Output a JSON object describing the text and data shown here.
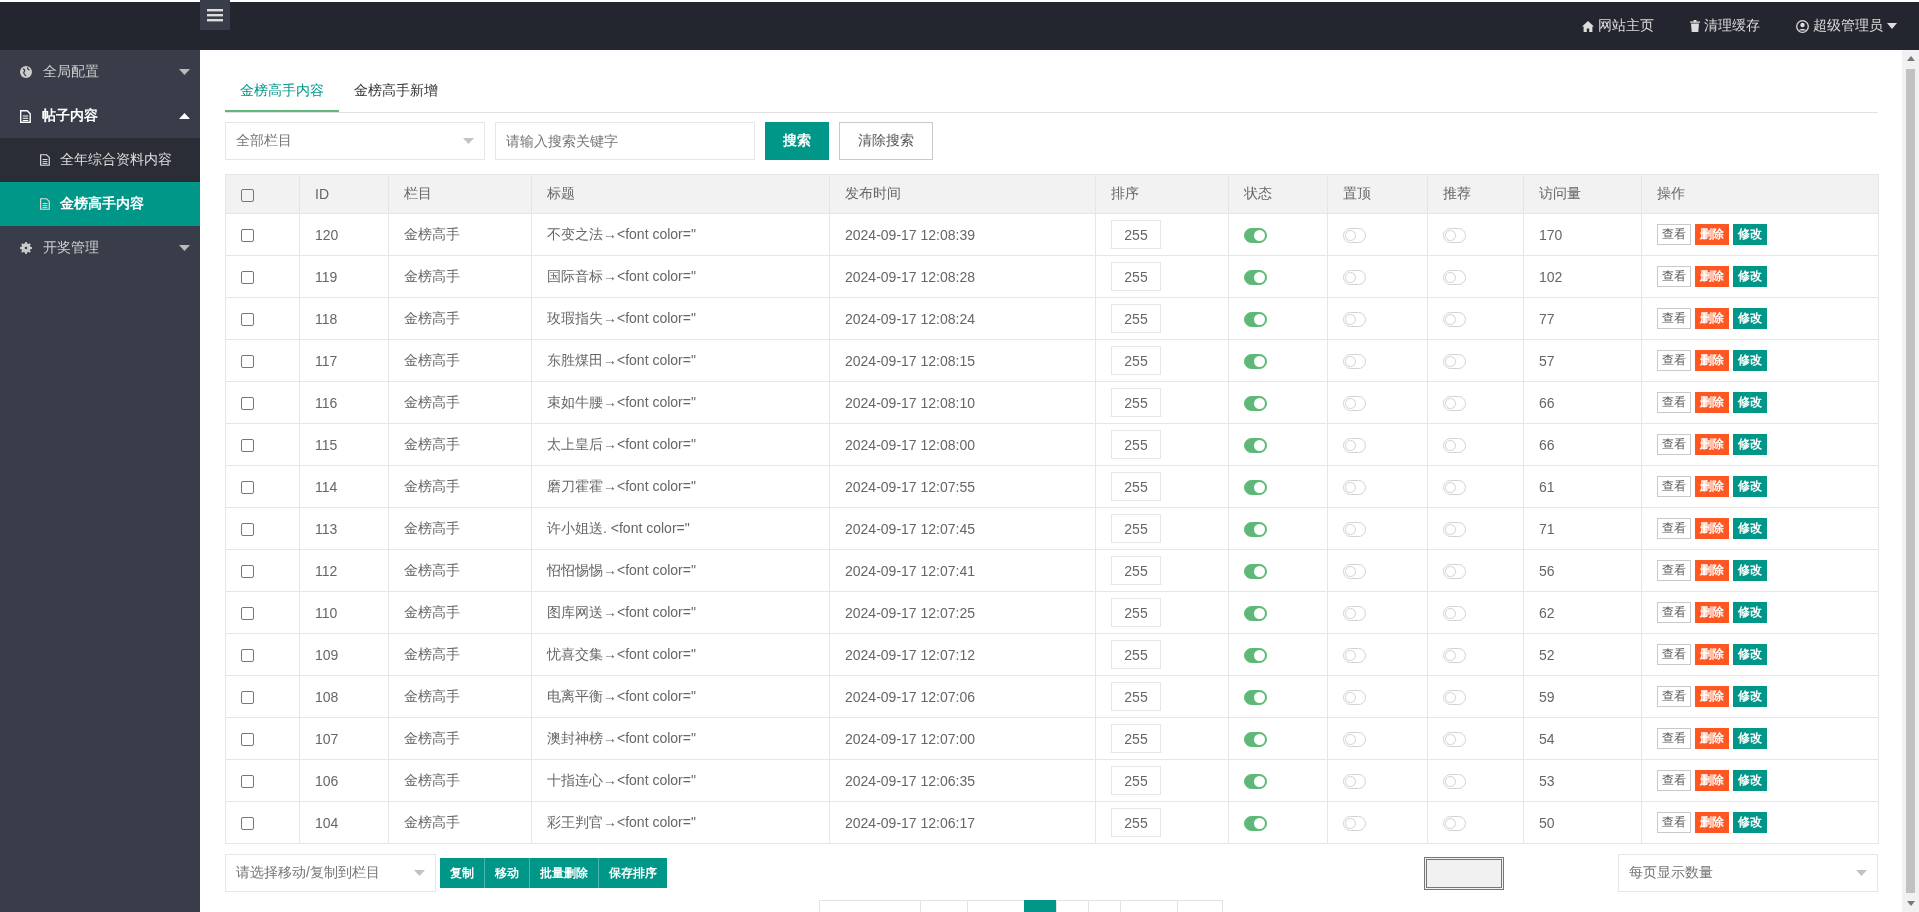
{
  "topbar": {
    "links": [
      {
        "label": "网站主页"
      },
      {
        "label": "清理缓存"
      },
      {
        "label": "超级管理员"
      }
    ]
  },
  "sidebar": {
    "items": [
      {
        "label": "全局配置",
        "expanded": false
      },
      {
        "label": "帖子内容",
        "expanded": true,
        "children": [
          {
            "label": "全年综合资料内容",
            "selected": false
          },
          {
            "label": "金榜高手内容",
            "selected": true
          }
        ]
      },
      {
        "label": "开奖管理",
        "expanded": false
      }
    ]
  },
  "tabs": [
    {
      "label": "金榜高手内容",
      "selected": true
    },
    {
      "label": "金榜高手新增",
      "selected": false
    }
  ],
  "search": {
    "category": "全部栏目",
    "placeholder": "请输入搜索关键字",
    "search_button": "搜索",
    "clear_button": "清除搜索"
  },
  "table": {
    "select_all_checked": false,
    "columns": [
      "ID",
      "栏目",
      "标题",
      "发布时间",
      "排序",
      "状态",
      "置顶",
      "推荐",
      "访问量",
      "操作"
    ],
    "rows": [
      {
        "id": "120",
        "category": "金榜高手",
        "title": "不变之法→<font color=\"",
        "time": "2024-09-17 12:08:39",
        "sort": "255",
        "status": true,
        "top": false,
        "recommend": false,
        "views": "170",
        "checked": false,
        "actions": [
          {
            "label": "查看",
            "kind": "plain"
          },
          {
            "label": "删除",
            "kind": "danger"
          },
          {
            "label": "修改",
            "kind": "primary"
          }
        ]
      },
      {
        "id": "119",
        "category": "金榜高手",
        "title": "国际音标→<font color=\"",
        "time": "2024-09-17 12:08:28",
        "sort": "255",
        "status": true,
        "top": false,
        "recommend": false,
        "views": "102",
        "checked": false,
        "actions": [
          {
            "label": "查看",
            "kind": "plain"
          },
          {
            "label": "删除",
            "kind": "danger"
          },
          {
            "label": "修改",
            "kind": "primary"
          }
        ]
      },
      {
        "id": "118",
        "category": "金榜高手",
        "title": "玫瑕指失→<font color=\"",
        "time": "2024-09-17 12:08:24",
        "sort": "255",
        "status": true,
        "top": false,
        "recommend": false,
        "views": "77",
        "checked": false,
        "actions": [
          {
            "label": "查看",
            "kind": "plain"
          },
          {
            "label": "删除",
            "kind": "danger"
          },
          {
            "label": "修改",
            "kind": "primary"
          }
        ]
      },
      {
        "id": "117",
        "category": "金榜高手",
        "title": "东胜煤田→<font color=\"",
        "time": "2024-09-17 12:08:15",
        "sort": "255",
        "status": true,
        "top": false,
        "recommend": false,
        "views": "57",
        "checked": false,
        "actions": [
          {
            "label": "查看",
            "kind": "plain"
          },
          {
            "label": "删除",
            "kind": "danger"
          },
          {
            "label": "修改",
            "kind": "primary"
          }
        ]
      },
      {
        "id": "116",
        "category": "金榜高手",
        "title": "束如牛腰→<font color=\"",
        "time": "2024-09-17 12:08:10",
        "sort": "255",
        "status": true,
        "top": false,
        "recommend": false,
        "views": "66",
        "checked": false,
        "actions": [
          {
            "label": "查看",
            "kind": "plain"
          },
          {
            "label": "删除",
            "kind": "danger"
          },
          {
            "label": "修改",
            "kind": "primary"
          }
        ]
      },
      {
        "id": "115",
        "category": "金榜高手",
        "title": "太上皇后→<font color=\"",
        "time": "2024-09-17 12:08:00",
        "sort": "255",
        "status": true,
        "top": false,
        "recommend": false,
        "views": "66",
        "checked": false,
        "actions": [
          {
            "label": "查看",
            "kind": "plain"
          },
          {
            "label": "删除",
            "kind": "danger"
          },
          {
            "label": "修改",
            "kind": "primary"
          }
        ]
      },
      {
        "id": "114",
        "category": "金榜高手",
        "title": "磨刀霍霍→<font color=\"",
        "time": "2024-09-17 12:07:55",
        "sort": "255",
        "status": true,
        "top": false,
        "recommend": false,
        "views": "61",
        "checked": false,
        "actions": [
          {
            "label": "查看",
            "kind": "plain"
          },
          {
            "label": "删除",
            "kind": "danger"
          },
          {
            "label": "修改",
            "kind": "primary"
          }
        ]
      },
      {
        "id": "113",
        "category": "金榜高手",
        "title": "许小姐送. <font color=\"",
        "time": "2024-09-17 12:07:45",
        "sort": "255",
        "status": true,
        "top": false,
        "recommend": false,
        "views": "71",
        "checked": false,
        "actions": [
          {
            "label": "查看",
            "kind": "plain"
          },
          {
            "label": "删除",
            "kind": "danger"
          },
          {
            "label": "修改",
            "kind": "primary"
          }
        ]
      },
      {
        "id": "112",
        "category": "金榜高手",
        "title": "怊怊惕惕→<font color=\"",
        "time": "2024-09-17 12:07:41",
        "sort": "255",
        "status": true,
        "top": false,
        "recommend": false,
        "views": "56",
        "checked": false,
        "actions": [
          {
            "label": "查看",
            "kind": "plain"
          },
          {
            "label": "删除",
            "kind": "danger"
          },
          {
            "label": "修改",
            "kind": "primary"
          }
        ]
      },
      {
        "id": "110",
        "category": "金榜高手",
        "title": "图库网送→<font color=\"",
        "time": "2024-09-17 12:07:25",
        "sort": "255",
        "status": true,
        "top": false,
        "recommend": false,
        "views": "62",
        "checked": false,
        "actions": [
          {
            "label": "查看",
            "kind": "plain"
          },
          {
            "label": "删除",
            "kind": "danger"
          },
          {
            "label": "修改",
            "kind": "primary"
          }
        ]
      },
      {
        "id": "109",
        "category": "金榜高手",
        "title": "忧喜交集→<font color=\"",
        "time": "2024-09-17 12:07:12",
        "sort": "255",
        "status": true,
        "top": false,
        "recommend": false,
        "views": "52",
        "checked": false,
        "actions": [
          {
            "label": "查看",
            "kind": "plain"
          },
          {
            "label": "删除",
            "kind": "danger"
          },
          {
            "label": "修改",
            "kind": "primary"
          }
        ]
      },
      {
        "id": "108",
        "category": "金榜高手",
        "title": "电离平衡→<font color=\"",
        "time": "2024-09-17 12:07:06",
        "sort": "255",
        "status": true,
        "top": false,
        "recommend": false,
        "views": "59",
        "checked": false,
        "actions": [
          {
            "label": "查看",
            "kind": "plain"
          },
          {
            "label": "删除",
            "kind": "danger"
          },
          {
            "label": "修改",
            "kind": "primary"
          }
        ]
      },
      {
        "id": "107",
        "category": "金榜高手",
        "title": "澳封神榜→<font color=\"",
        "time": "2024-09-17 12:07:00",
        "sort": "255",
        "status": true,
        "top": false,
        "recommend": false,
        "views": "54",
        "checked": false,
        "actions": [
          {
            "label": "查看",
            "kind": "plain"
          },
          {
            "label": "删除",
            "kind": "danger"
          },
          {
            "label": "修改",
            "kind": "primary"
          }
        ]
      },
      {
        "id": "106",
        "category": "金榜高手",
        "title": "十指连心→<font color=\"",
        "time": "2024-09-17 12:06:35",
        "sort": "255",
        "status": true,
        "top": false,
        "recommend": false,
        "views": "53",
        "checked": false,
        "actions": [
          {
            "label": "查看",
            "kind": "plain"
          },
          {
            "label": "删除",
            "kind": "danger"
          },
          {
            "label": "修改",
            "kind": "primary"
          }
        ]
      },
      {
        "id": "104",
        "category": "金榜高手",
        "title": "彩王判官→<font color=\"",
        "time": "2024-09-17 12:06:17",
        "sort": "255",
        "status": true,
        "top": false,
        "recommend": false,
        "views": "50",
        "checked": false,
        "actions": [
          {
            "label": "查看",
            "kind": "plain"
          },
          {
            "label": "删除",
            "kind": "danger"
          },
          {
            "label": "修改",
            "kind": "primary"
          }
        ]
      }
    ]
  },
  "footer": {
    "move_placeholder": "请选择移动/复制到栏目",
    "actions": [
      "复制",
      "移动",
      "批量删除",
      "保存排序"
    ],
    "per_page_placeholder": "每页显示数量"
  },
  "pagination": [
    {
      "selected": false
    },
    {
      "selected": false
    },
    {
      "selected": false
    },
    {
      "selected": true
    },
    {
      "selected": false
    },
    {
      "selected": false
    },
    {
      "selected": false
    },
    {
      "selected": false
    }
  ]
}
